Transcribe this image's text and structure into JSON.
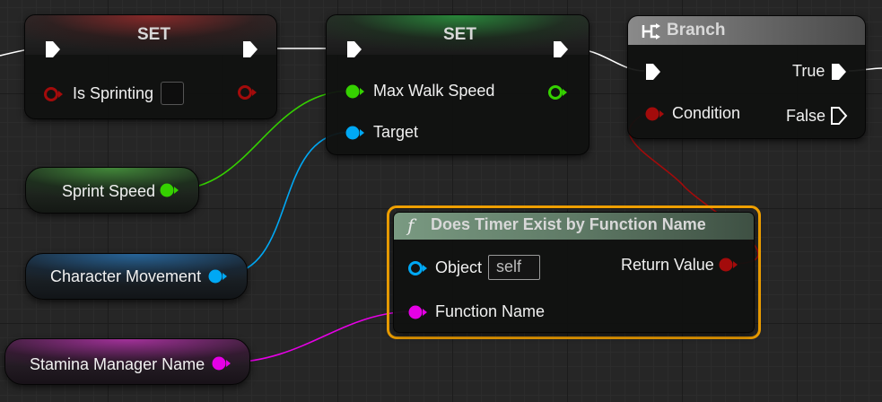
{
  "set_node_1": {
    "title": "SET",
    "variable_label": "Is Sprinting",
    "value_checked": false
  },
  "set_node_2": {
    "title": "SET",
    "variable_label": "Max Walk Speed",
    "target_label": "Target"
  },
  "branch_node": {
    "title": "Branch",
    "condition_label": "Condition",
    "true_label": "True",
    "false_label": "False"
  },
  "timer_node": {
    "title": "Does Timer Exist by Function Name",
    "function_glyph": "f",
    "object_label": "Object",
    "object_value": "self",
    "function_name_label": "Function Name",
    "return_label": "Return Value"
  },
  "variable_nodes": {
    "sprint_speed": "Sprint Speed",
    "character_movement": "Character Movement",
    "stamina_manager_name": "Stamina Manager Name"
  },
  "colors": {
    "boolean_pin": "#a30b0b",
    "float_pin": "#35d100",
    "object_pin": "#00a8f4",
    "name_pin": "#e600e6",
    "exec_wire": "#ffffff",
    "selection_outline": "#f0a000"
  }
}
